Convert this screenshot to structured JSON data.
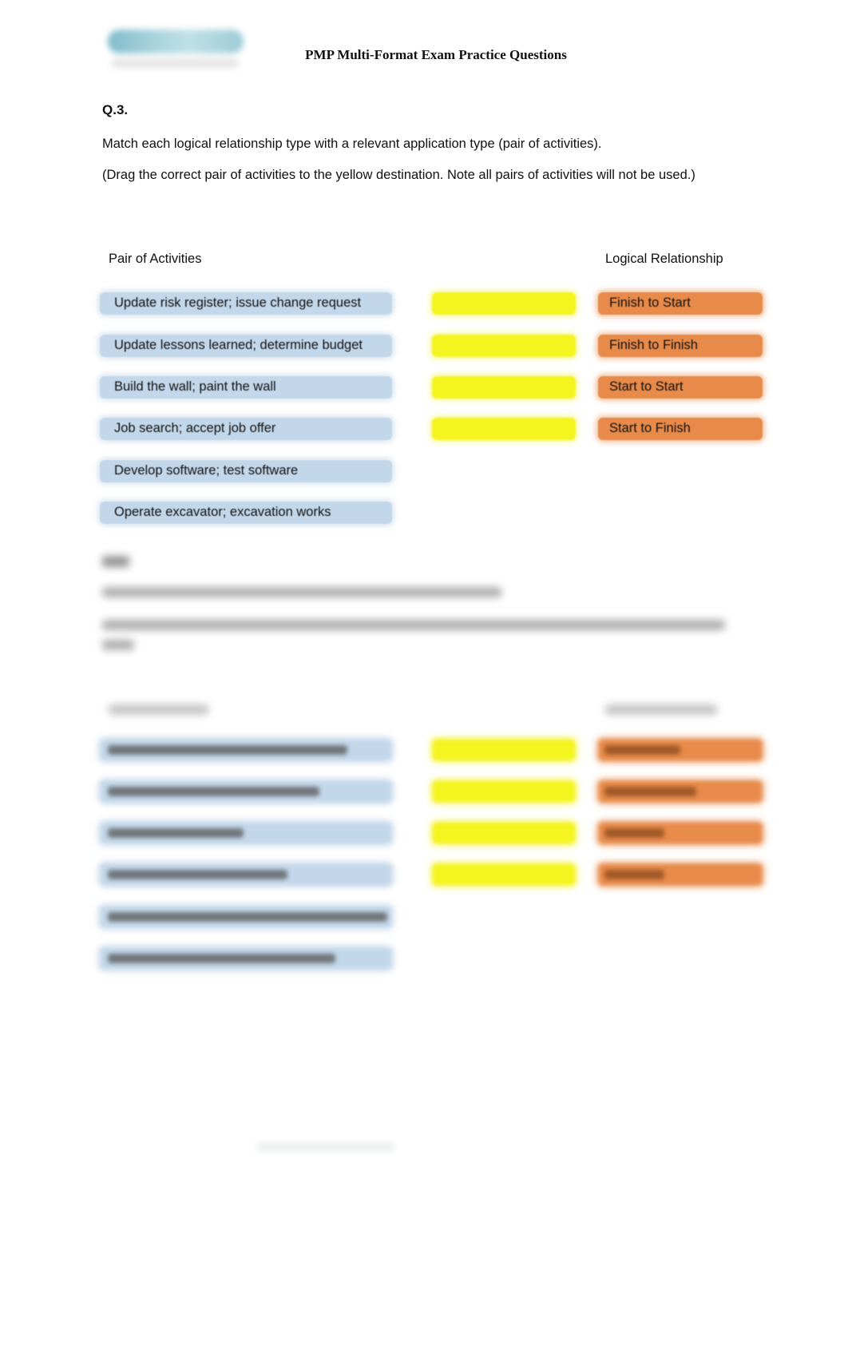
{
  "header": {
    "logo": "training-provider-logo",
    "title": "PMP Multi-Format Exam Practice Questions"
  },
  "question": {
    "label": "Q.3.",
    "instruction": "Match each logical relationship type with a relevant application type (pair of activities).",
    "note": "(Drag the correct pair of activities to the yellow destination. Note all pairs of activities will not be used.)",
    "left_header": "Pair of Activities",
    "right_header": "Logical Relationship",
    "pairs": [
      "Update risk register; issue change request",
      "Update lessons learned; determine budget",
      "Build the wall; paint the wall",
      "Job search; accept job offer",
      "Develop software; test software",
      "Operate excavator; excavation works"
    ],
    "drop_targets_count": 4,
    "relationships": [
      "Finish to Start",
      "Finish to Finish",
      "Start to Start",
      "Start to Finish"
    ],
    "colors": {
      "pair_box": "#c3d7ea",
      "drop_target": "#f4f41e",
      "relationship_box": "#e88a4a"
    }
  },
  "next_question": {
    "blurred": true,
    "pairs_count": 6,
    "drop_targets_count": 4,
    "types_count": 4
  }
}
